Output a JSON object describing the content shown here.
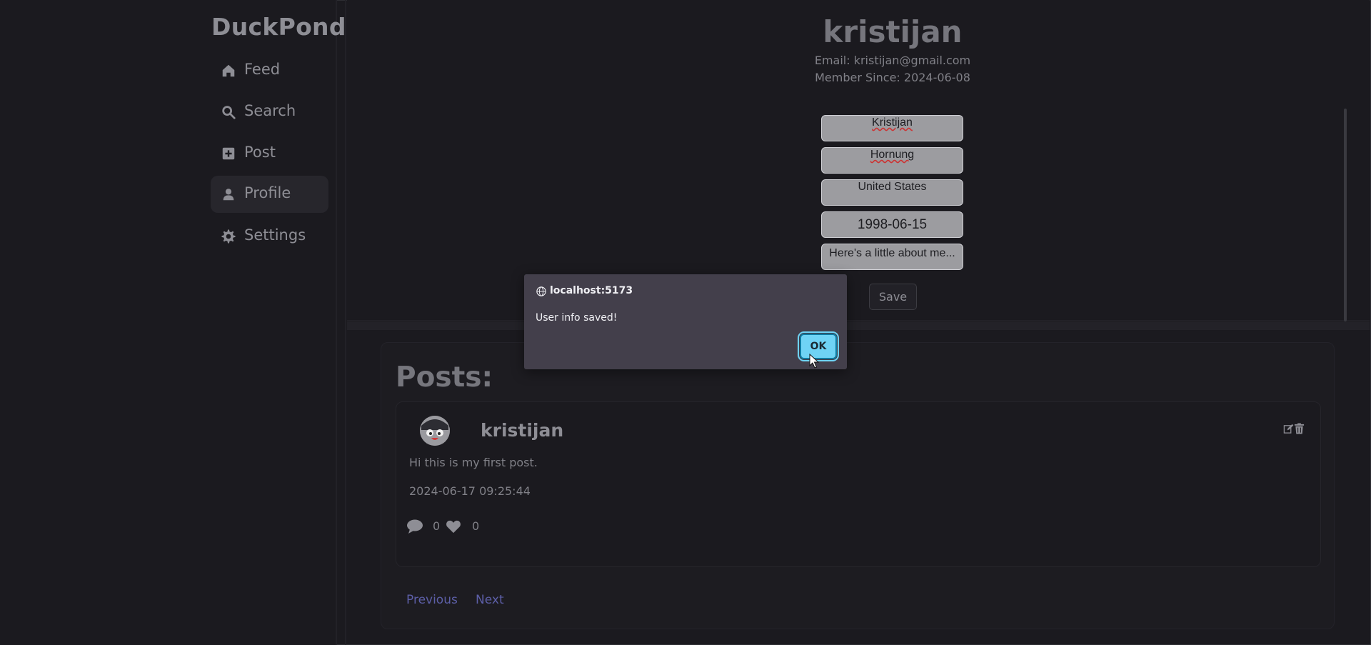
{
  "sidebar": {
    "brand": "DuckPond",
    "items": [
      {
        "label": "Feed",
        "icon": "home-icon"
      },
      {
        "label": "Search",
        "icon": "search-icon"
      },
      {
        "label": "Post",
        "icon": "plus-square-icon"
      },
      {
        "label": "Profile",
        "icon": "user-icon",
        "active": true
      },
      {
        "label": "Settings",
        "icon": "gear-icon"
      }
    ]
  },
  "profile": {
    "username": "kristijan",
    "email_line": "Email: kristijan@gmail.com",
    "member_since_line": "Member Since: 2024-06-08",
    "fields": {
      "first_name": "Kristijan",
      "last_name": "Hornung",
      "country": "United States",
      "birthdate": "1998-06-15",
      "bio_placeholder": "Here's a little about me..."
    },
    "save_label": "Save"
  },
  "posts": {
    "title": "Posts:",
    "items": [
      {
        "author": "kristijan",
        "body": "Hi this is my first post.",
        "timestamp": "2024-06-17 09:25:44",
        "comments": "0",
        "likes": "0"
      }
    ],
    "pager": {
      "previous": "Previous",
      "next": "Next"
    }
  },
  "dialog": {
    "origin": "localhost:5173",
    "message": "User info saved!",
    "ok_label": "OK"
  },
  "colors": {
    "background": "#1b1a1f",
    "dialog": "#433f4b",
    "ok_button": "#6fd3f5",
    "link": "#5d5fa8"
  }
}
